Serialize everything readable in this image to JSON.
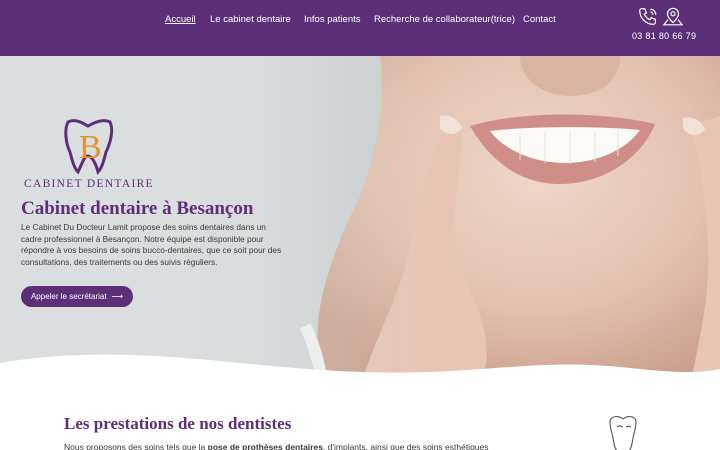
{
  "nav": {
    "items": [
      {
        "label": "Accueil",
        "active": true
      },
      {
        "label": "Le cabinet dentaire"
      },
      {
        "label": "Infos patients"
      },
      {
        "label": "Recherche de collaborateur(trice)"
      },
      {
        "label": "Contact"
      }
    ],
    "phone": "03 81 80 66 79",
    "icons": [
      "phone-icon",
      "map-pin-icon"
    ]
  },
  "hero": {
    "logo_text": "CABINET DENTAIRE",
    "title": "Cabinet dentaire à Besançon",
    "description": "Le Cabinet Du Docteur Lamit propose des soins dentaires dans un cadre professionnel à Besançon. Notre équipe est disponible pour répondre à vos besoins de soins bucco-dentaires, que ce soit pour des consultations, des traitements ou des suivis réguliers.",
    "cta_label": "Appeler le secrétariat"
  },
  "services": {
    "title": "Les prestations de nos dentistes",
    "text_before": "Nous proposons des soins tels que la ",
    "text_bold": "pose de prothèses dentaires",
    "text_after": ", d'implants, ainsi que des soins esthétiques"
  },
  "colors": {
    "brand": "#5d2f79",
    "accent": "#e0962b",
    "background": "#ffffff"
  }
}
